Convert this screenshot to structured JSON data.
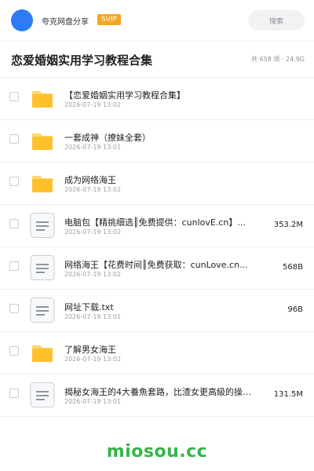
{
  "header": {
    "account_name": "夸克网盘分享",
    "badge": "SVIP",
    "search_placeholder": "搜索",
    "avatar_color": "#2f7bf5",
    "badge_color": "#f6a623"
  },
  "page": {
    "title": "恋爱婚姻实用学习教程合集",
    "summary": "共 658 项 · 24.9G"
  },
  "files": [
    {
      "type": "folder",
      "icon": "folder-icon",
      "name": "【恋爱婚姻实用学习教程合集】",
      "date": "2026-07-19 13:02",
      "size": ""
    },
    {
      "type": "folder",
      "icon": "folder-icon",
      "name": "一套成神（撩妹全套）",
      "date": "2026-07-19 13:01",
      "size": ""
    },
    {
      "type": "folder",
      "icon": "folder-icon",
      "name": "成为网络海王",
      "date": "2026-07-19 13:02",
      "size": ""
    },
    {
      "type": "file",
      "icon": "document-icon",
      "name": "电脑包【精挑细选║免费提供：cunlovE.cn】...",
      "date": "2026-07-19 13:02",
      "size": "353.2M"
    },
    {
      "type": "file",
      "icon": "document-icon",
      "name": "网络海王【花费时间║免费获取：cunLove.cn...",
      "date": "2026-07-19 13:02",
      "size": "568B"
    },
    {
      "type": "file",
      "icon": "document-icon",
      "name": "网址下载.txt",
      "date": "2026-07-19 13:01",
      "size": "96B"
    },
    {
      "type": "folder",
      "icon": "folder-icon",
      "name": "了解男女海王",
      "date": "2026-07-19 13:02",
      "size": ""
    },
    {
      "type": "file",
      "icon": "document-icon",
      "name": "揭秘女海王的4大養魚套路，比渣女更高級的操作！丨兩",
      "date": "2026-07-19 13:01",
      "size": "131.5M"
    }
  ],
  "watermark": "miosou.cc",
  "colors": {
    "folder": "#ffc02e",
    "folder_tab": "#ffd86b",
    "watermark": "#33b54a"
  }
}
